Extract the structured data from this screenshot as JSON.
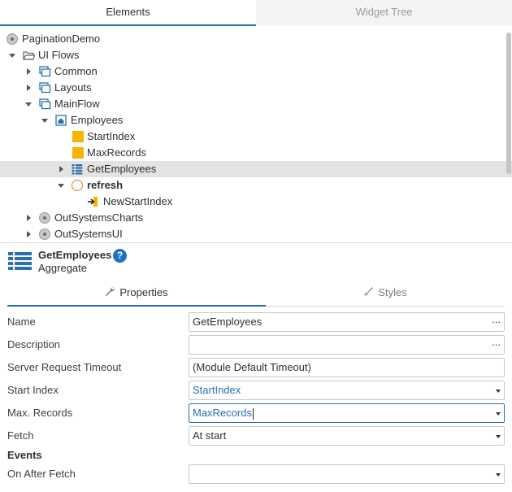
{
  "top_tabs": [
    {
      "label": "Elements",
      "active": true
    },
    {
      "label": "Widget Tree",
      "active": false
    }
  ],
  "tree": {
    "items": [
      {
        "label": "PaginationDemo",
        "icon": "module-icon"
      },
      {
        "label": "UI Flows",
        "icon": "folder-open-icon"
      },
      {
        "label": "Common",
        "icon": "ui-flow-icon"
      },
      {
        "label": "Layouts",
        "icon": "ui-flow-icon"
      },
      {
        "label": "MainFlow",
        "icon": "ui-flow-icon"
      },
      {
        "label": "Employees",
        "icon": "screen-icon"
      },
      {
        "label": "StartIndex",
        "icon": "local-variable-icon"
      },
      {
        "label": "MaxRecords",
        "icon": "local-variable-icon"
      },
      {
        "label": "GetEmployees",
        "icon": "aggregate-icon"
      },
      {
        "label": "refresh",
        "icon": "screen-action-icon"
      },
      {
        "label": "NewStartIndex",
        "icon": "input-parameter-icon"
      },
      {
        "label": "OutSystemsCharts",
        "icon": "module-icon"
      },
      {
        "label": "OutSystemsUI",
        "icon": "module-icon"
      }
    ]
  },
  "header": {
    "title": "GetEmployees",
    "subtitle": "Aggregate",
    "help": "?"
  },
  "prop_tabs": [
    {
      "label": "Properties",
      "icon": "wrench-icon",
      "active": true
    },
    {
      "label": "Styles",
      "icon": "brush-icon",
      "active": false
    }
  ],
  "properties": {
    "name": {
      "label": "Name",
      "value": "GetEmployees",
      "more": "..."
    },
    "description": {
      "label": "Description",
      "value": "",
      "more": "..."
    },
    "timeout": {
      "label": "Server Request Timeout",
      "value": "(Module Default Timeout)"
    },
    "start_index": {
      "label": "Start Index",
      "value": "StartIndex"
    },
    "max_records": {
      "label": "Max. Records",
      "value": "MaxRecords"
    },
    "fetch": {
      "label": "Fetch",
      "value": "At start"
    }
  },
  "events": {
    "title": "Events",
    "on_after_fetch": {
      "label": "On After Fetch",
      "value": ""
    }
  },
  "colors": {
    "accent": "#2a6fb0",
    "selected_row": "#e3e3e3",
    "variable": "#f4b400",
    "action": "#f07a1a",
    "help": "#1a73c9"
  }
}
